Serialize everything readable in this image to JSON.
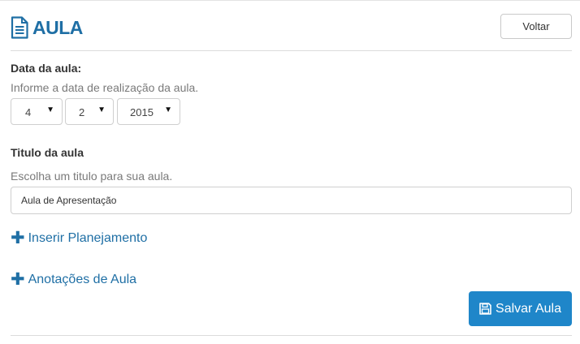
{
  "header": {
    "title": "AULA",
    "back_label": "Voltar"
  },
  "date": {
    "label": "Data da aula:",
    "help": "Informe a data de realização da aula.",
    "day": "4",
    "month": "2",
    "year": "2015"
  },
  "title_field": {
    "label": "Titulo da aula",
    "help": "Escolha um titulo para sua aula.",
    "value": "Aula de Apresentação"
  },
  "links": {
    "planning": "Inserir Planejamento",
    "notes": "Anotações de Aula"
  },
  "actions": {
    "save_label": "Salvar Aula"
  },
  "colors": {
    "accent": "#1f6fa5",
    "primary_button": "#1f86c9"
  },
  "icons": {
    "title": "file-text-icon",
    "plus": "plus-icon",
    "save": "floppy-disk-icon",
    "dropdown": "caret-down-icon"
  }
}
